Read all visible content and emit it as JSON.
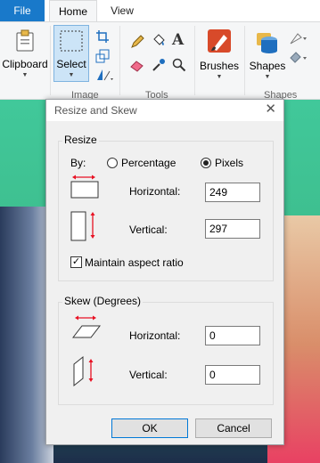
{
  "ribbon": {
    "tabs": [
      {
        "label": "File"
      },
      {
        "label": "Home"
      },
      {
        "label": "View"
      }
    ],
    "buttons": {
      "clipboard": "Clipboard",
      "select": "Select",
      "brushes": "Brushes",
      "shapes": "Shapes"
    },
    "groups": {
      "image": "Image",
      "tools": "Tools",
      "shapes": "Shapes"
    }
  },
  "dialog": {
    "title": "Resize and Skew",
    "resize": {
      "legend": "Resize",
      "by_label": "By:",
      "percentage_label": "Percentage",
      "pixels_label": "Pixels",
      "selected_unit": "Pixels",
      "horizontal_label": "Horizontal:",
      "horizontal_value": "249",
      "vertical_label": "Vertical:",
      "vertical_value": "297",
      "aspect_label": "Maintain aspect ratio",
      "aspect_checked": true
    },
    "skew": {
      "legend": "Skew (Degrees)",
      "horizontal_label": "Horizontal:",
      "horizontal_value": "0",
      "vertical_label": "Vertical:",
      "vertical_value": "0"
    },
    "ok_label": "OK",
    "cancel_label": "Cancel"
  },
  "colors": {
    "file_tab": "#1979ca",
    "select_highlight": "#cce4f7",
    "arrow_red": "#e81123",
    "default_button_border": "#0078d7"
  }
}
